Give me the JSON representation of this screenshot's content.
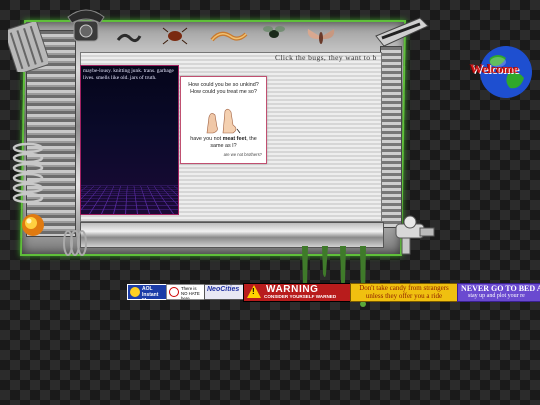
{
  "header": {
    "instruction": "Click the bugs, they want to b"
  },
  "grid_panel": {
    "text": "maybe-lousy. knitting junk. trans. garbage lives. smells like old. jars of truth."
  },
  "feet_card": {
    "question": "How could you be so unkind? How could you treat me so?",
    "answer_pre": "have you not ",
    "answer_bold": "meat feet",
    "answer_post": ", the same as I?",
    "note": "are we not brothers?"
  },
  "welcome": {
    "text": "Welcome"
  },
  "badges": {
    "aol": "AOL Instant Messenger",
    "nohate": "There is NO HATE here",
    "neocities": "NeoCities",
    "warning_title": "WARNING",
    "warning_sub": "CONSIDER YOURSELF WARNED",
    "candy": "Don't take candy from strangers unless they offer you a ride",
    "bed_line1": "NEVER GO TO BED A",
    "bed_line2": "stay up and plot your re"
  },
  "colors": {
    "frame_glow": "#5fbf3a",
    "warning_red": "#b81c1c",
    "candy_yellow": "#f0c010",
    "bed_purple": "#6a4ad0",
    "welcome_red": "#d01818"
  },
  "icons": [
    "telephone-icon",
    "radiator-icon",
    "spring-icon",
    "fire-orb-icon",
    "stapler-icon",
    "faucet-icon",
    "globe-icon",
    "bug-icon",
    "cockroach-icon",
    "worm-icon",
    "fly-icon",
    "moth-icon",
    "goo-drip-icon"
  ]
}
